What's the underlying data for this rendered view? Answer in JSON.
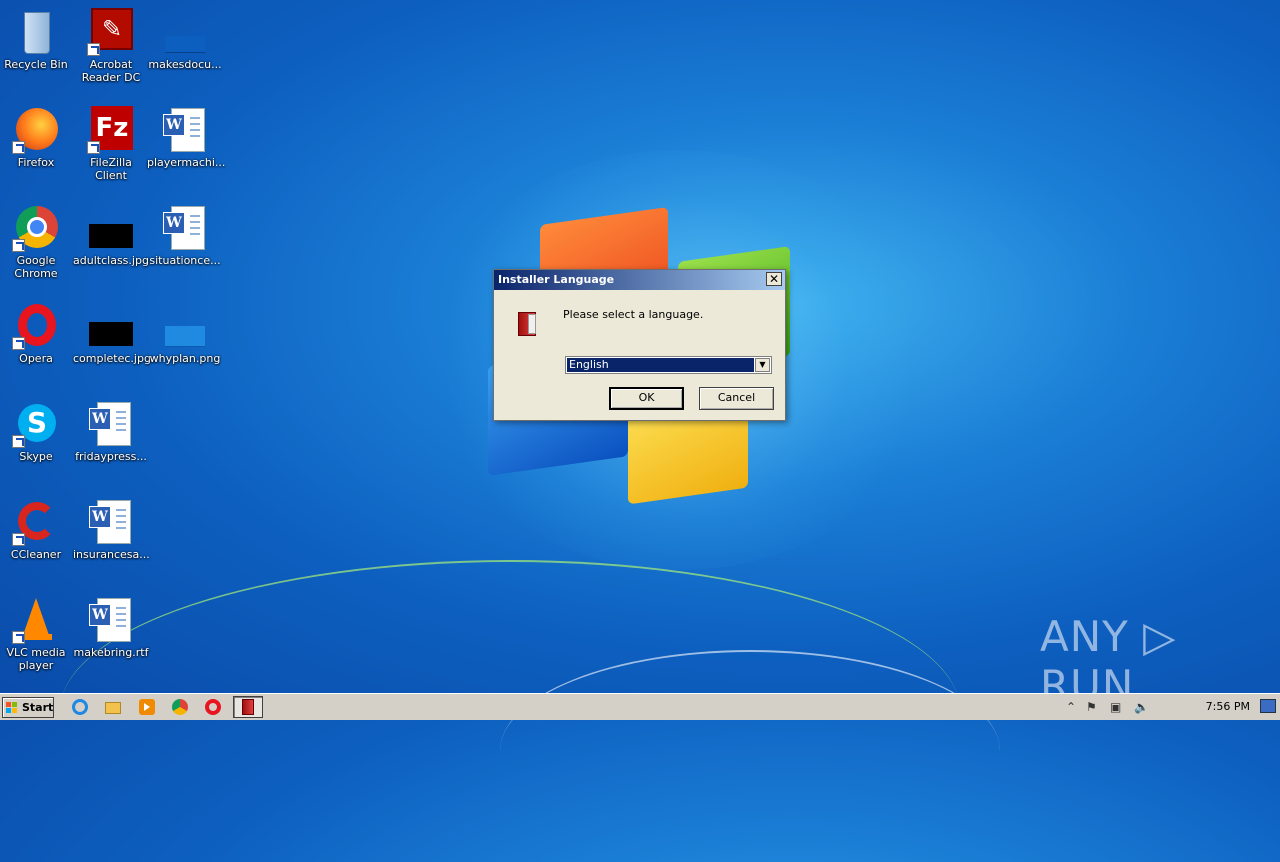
{
  "desktop": {
    "icons": [
      {
        "label": "Recycle Bin"
      },
      {
        "label": "Acrobat Reader DC"
      },
      {
        "label": "makesdocu..."
      },
      {
        "label": "Firefox"
      },
      {
        "label": "FileZilla Client"
      },
      {
        "label": "playermachi..."
      },
      {
        "label": "Google Chrome"
      },
      {
        "label": "adultclass.jpg"
      },
      {
        "label": "situationce..."
      },
      {
        "label": "Opera"
      },
      {
        "label": "completec.jpg"
      },
      {
        "label": "whyplan.png"
      },
      {
        "label": "Skype"
      },
      {
        "label": "fridaypress..."
      },
      {
        "label": "CCleaner"
      },
      {
        "label": "insurancesa..."
      },
      {
        "label": "VLC media player"
      },
      {
        "label": "makebring.rtf"
      }
    ]
  },
  "dialog": {
    "title": "Installer Language",
    "close_glyph": "✕",
    "message": "Please select a language.",
    "language_selected": "English",
    "ok_label": "OK",
    "cancel_label": "Cancel"
  },
  "taskbar": {
    "start_label": "Start",
    "clock": "7:56 PM",
    "tray_up_glyph": "⌃"
  },
  "watermark": "ANY ▷ RUN",
  "colors": {
    "dialog_title_start": "#0a246a",
    "dialog_title_end": "#a6caf0",
    "selection": "#0a246a"
  }
}
